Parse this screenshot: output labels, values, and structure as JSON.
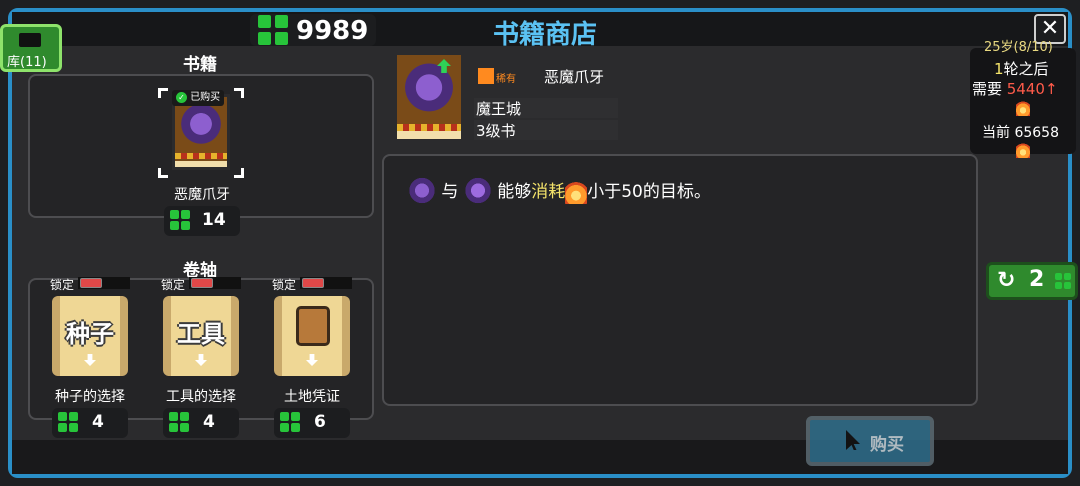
{
  "header": {
    "currency_amount": "9989",
    "title": "书籍商店"
  },
  "storage": {
    "label": "库(11)"
  },
  "books_section": {
    "title": "书籍",
    "book": {
      "name": "恶魔爪牙",
      "status": "已购买",
      "price": "14"
    }
  },
  "scrolls_section": {
    "title": "卷轴",
    "scrolls": [
      {
        "lock_label": "锁定",
        "word": "种子",
        "name": "种子的选择",
        "price": "4"
      },
      {
        "lock_label": "锁定",
        "word": "工具",
        "name": "工具的选择",
        "price": "4"
      },
      {
        "lock_label": "锁定",
        "word": "",
        "name": "土地凭证",
        "price": "6"
      }
    ]
  },
  "detail": {
    "rarity_label": "稀有",
    "name": "恶魔爪牙",
    "location": "魔王城",
    "level": "3级书",
    "desc_and": "与",
    "desc_can": "能够",
    "desc_keyword": "消耗",
    "desc_tail": "小于50的目标。"
  },
  "status": {
    "age": "25岁(8/10)",
    "rounds_num": "1",
    "rounds_text": "轮之后",
    "need_label": "需要",
    "need_value": "5440",
    "current_label": "当前",
    "current_value": "65658"
  },
  "refresh": {
    "count": "2"
  },
  "buy": {
    "label": "购买"
  },
  "colors": {
    "frame": "#2a8fc8",
    "clover": "#27c43a",
    "keyword": "#f4e36a",
    "need": "#ff5b4a",
    "buy_bg": "#2f6e8c"
  }
}
